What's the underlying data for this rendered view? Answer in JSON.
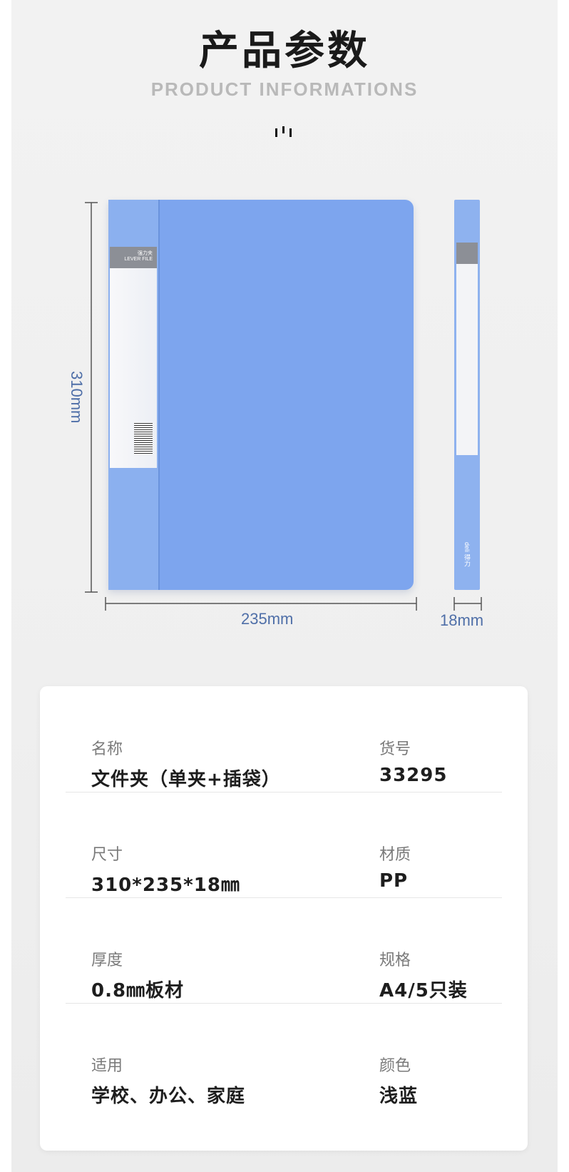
{
  "header": {
    "title": "产品参数",
    "subtitle": "PRODUCT INFORMATIONS"
  },
  "product_image": {
    "front_label_cn": "强力夹",
    "front_label_en": "LEVER FILE",
    "side_brand": "deli 得力"
  },
  "dimensions": {
    "height": "310mm",
    "width": "235mm",
    "depth": "18mm"
  },
  "specs": [
    {
      "left": {
        "key": "名称",
        "value": "文件夹（单夹+插袋）"
      },
      "right": {
        "key": "货号",
        "value": "33295"
      }
    },
    {
      "left": {
        "key": "尺寸",
        "value": "310*235*18㎜"
      },
      "right": {
        "key": "材质",
        "value": "PP"
      }
    },
    {
      "left": {
        "key": "厚度",
        "value": "0.8㎜板材"
      },
      "right": {
        "key": "规格",
        "value": "A4/5只装"
      }
    },
    {
      "left": {
        "key": "适用",
        "value": "学校、办公、家庭"
      },
      "right": {
        "key": "颜色",
        "value": "浅蓝"
      }
    }
  ],
  "colors": {
    "folder_blue": "#7da5ee",
    "dimension_text": "#4f6fa8",
    "background": "#efefef"
  }
}
